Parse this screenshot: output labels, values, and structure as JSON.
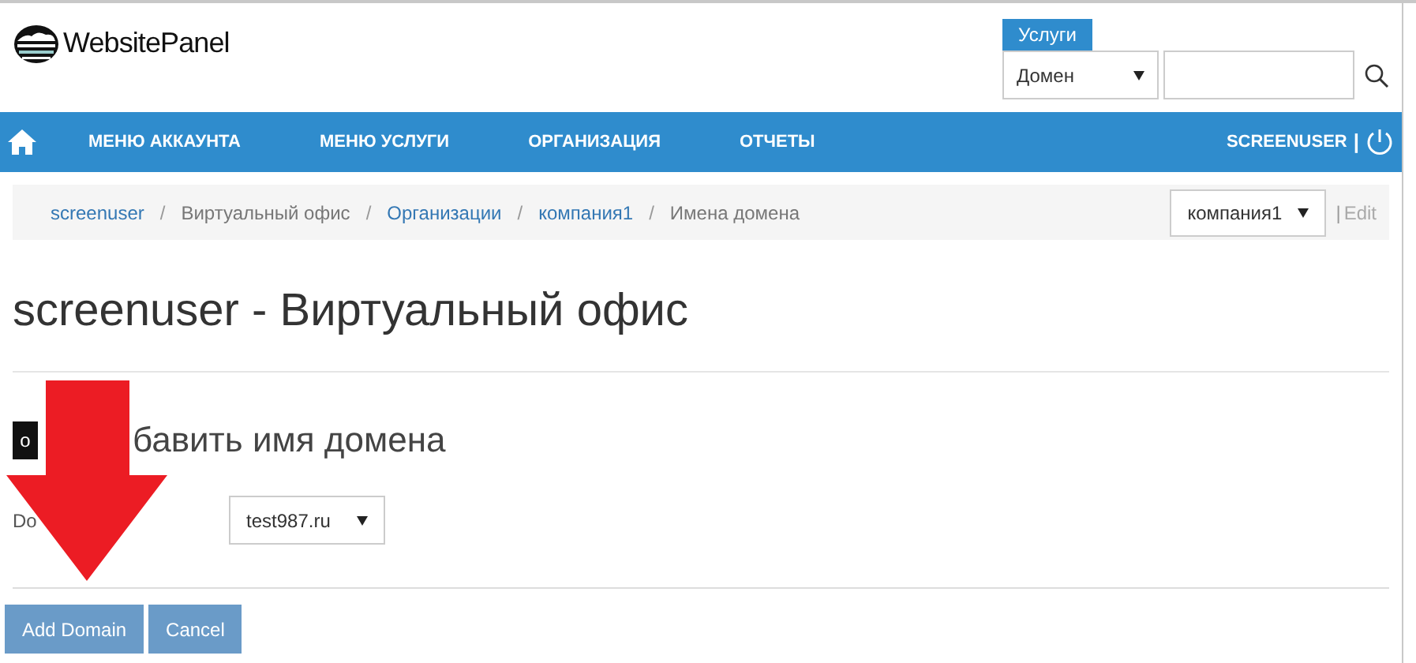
{
  "logo": {
    "text": "WebsitePanel"
  },
  "search": {
    "tab": "Услуги",
    "type": "Домен"
  },
  "nav": {
    "items": [
      "МЕНЮ АККАУНТА",
      "МЕНЮ УСЛУГИ",
      "ОРГАНИЗАЦИЯ",
      "ОТЧЕТЫ"
    ],
    "user": "SCREENUSER",
    "separator": "|"
  },
  "breadcrumb": {
    "items": [
      {
        "text": "screenuser",
        "link": true
      },
      {
        "separator": "/",
        "text": "Виртуальный офис",
        "link": false
      },
      {
        "separator": "/",
        "text": "Организации",
        "link": true
      },
      {
        "separator": "/",
        "text": "компания1",
        "link": true
      },
      {
        "separator": "/",
        "text": "Имена домена",
        "link": false
      }
    ],
    "org": "компания1",
    "edit_separator": "|",
    "edit": "Edit"
  },
  "page_title": "screenuser - Виртуальный офис",
  "section": {
    "icon_letter": "o",
    "title": "бавить имя домена"
  },
  "form": {
    "label": "Do",
    "domain": "test987.ru"
  },
  "buttons": [
    "Add Domain",
    "Cancel"
  ]
}
